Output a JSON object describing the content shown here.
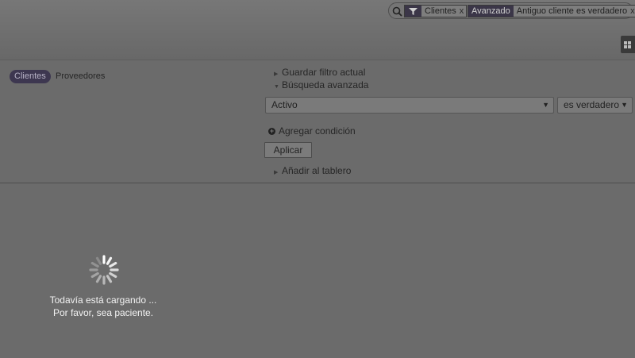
{
  "search": {
    "facets": [
      {
        "head_icon": "filter-icon",
        "value": "Clientes",
        "remove": "x"
      },
      {
        "head": "Avanzado",
        "value": "Antiguo cliente es verdadero",
        "remove": "x"
      }
    ]
  },
  "filters": {
    "clientes_label": "Clientes",
    "proveedores_label": "Proveedores"
  },
  "advanced": {
    "save_filter_label": "Guardar filtro actual",
    "advanced_search_label": "Búsqueda avanzada",
    "field_select_value": "Activo",
    "operator_select_value": "es verdadero",
    "add_condition_label": "Agregar condición",
    "apply_label": "Aplicar",
    "add_dashboard_label": "Añadir al tablero"
  },
  "loading": {
    "line1": "Todavía está cargando ...",
    "line2": "Por favor, sea paciente."
  }
}
